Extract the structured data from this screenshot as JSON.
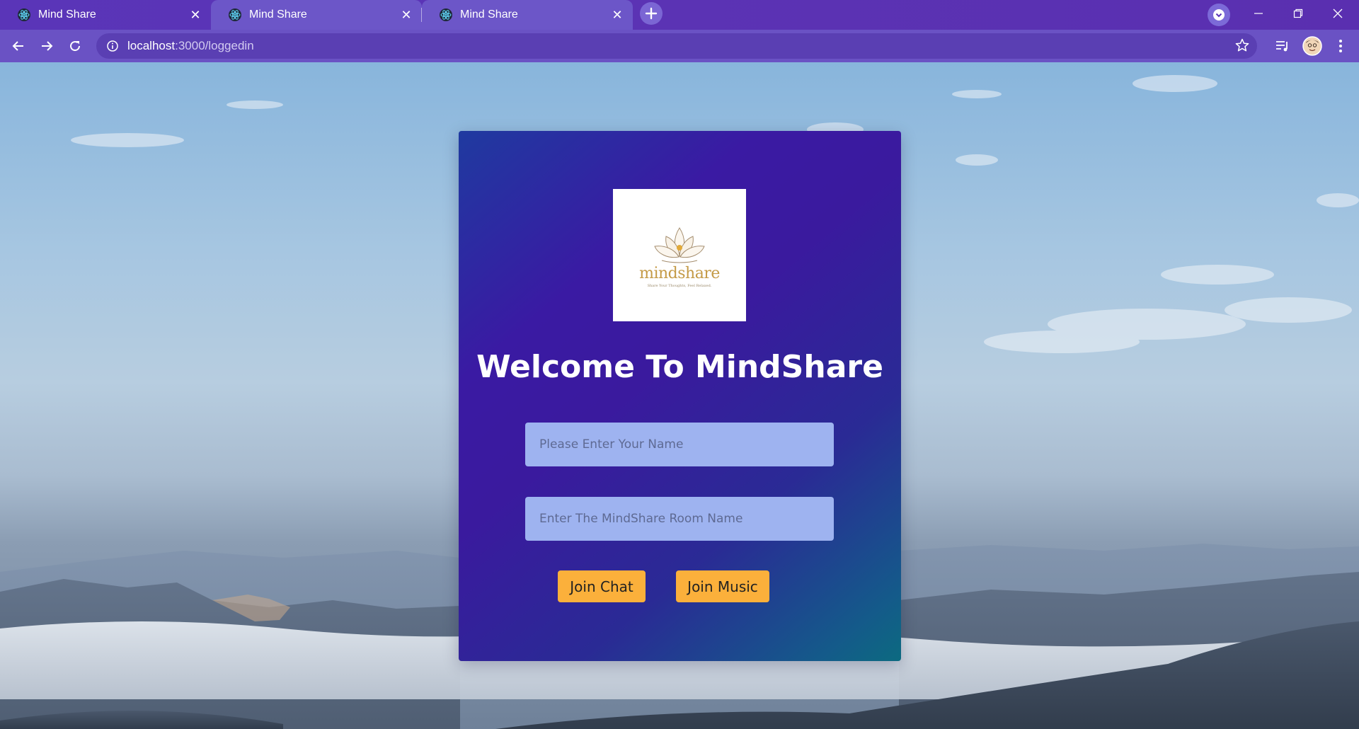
{
  "browser": {
    "tabs": [
      {
        "title": "Mind Share",
        "favicon": "react-icon",
        "active": false
      },
      {
        "title": "Mind Share",
        "favicon": "react-icon",
        "active": true
      },
      {
        "title": "Mind Share",
        "favicon": "react-icon",
        "active": false
      }
    ],
    "url_host": "localhost",
    "url_path": ":3000/loggedin",
    "colors": {
      "frame": "#5a35b8",
      "toolbar": "#6a52c4",
      "omnibox": "#5a3fb3"
    }
  },
  "page": {
    "logo": {
      "wordmark": "mindshare",
      "tagline": "Share Your Thoughts, Feel Relaxed.",
      "icon": "lotus-icon"
    },
    "heading": "Welcome To MindShare",
    "name_input": {
      "placeholder": "Please Enter Your Name",
      "value": ""
    },
    "room_input": {
      "placeholder": "Enter The MindShare Room Name",
      "value": ""
    },
    "join_chat_label": "Join Chat",
    "join_music_label": "Join Music",
    "colors": {
      "card_start": "#1f3aa0",
      "card_mid": "#3a1aa3",
      "card_end": "#0c6a80",
      "input_bg": "#9eb3f0",
      "button_bg": "#fbb03b"
    }
  }
}
